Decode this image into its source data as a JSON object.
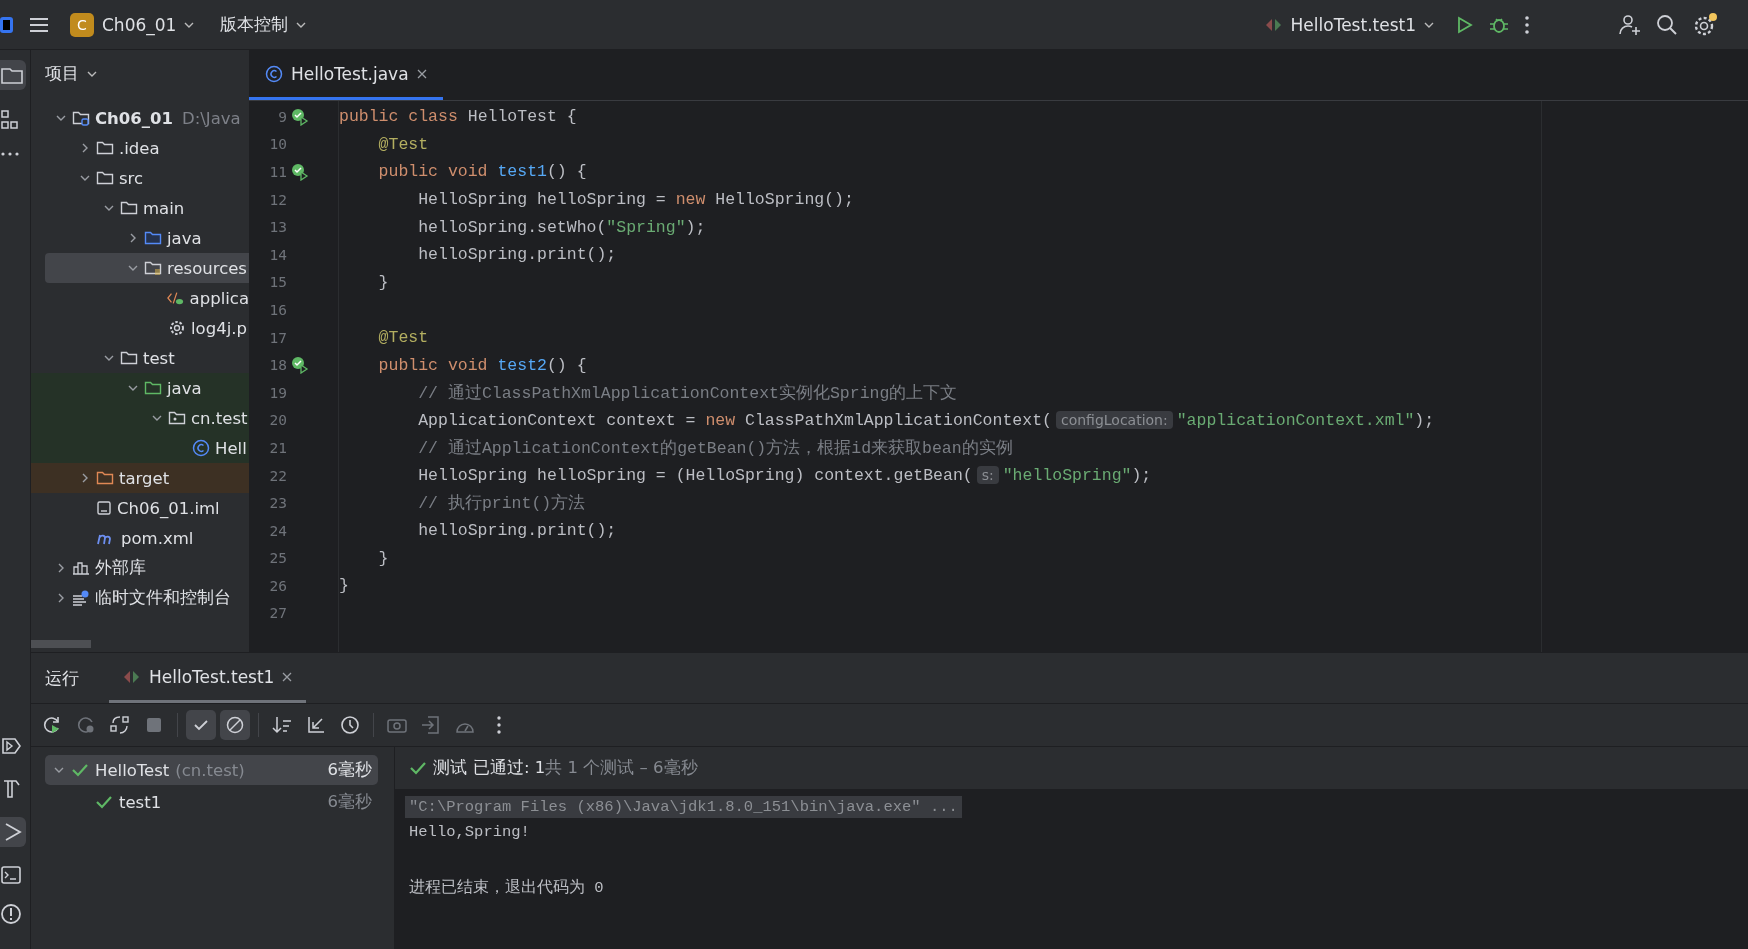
{
  "title_bar": {
    "project_badge": "C",
    "project": "Ch06_01",
    "vcs": "版本控制",
    "run_config": "HelloTest.test1",
    "settings_notice": true
  },
  "project_panel": {
    "title": "项目",
    "tree": [
      {
        "name": "Ch06_01",
        "hint": "D:\\Java",
        "kind": "project",
        "expanded": true,
        "selected": false,
        "children": [
          {
            "name": ".idea",
            "kind": "folder",
            "expanded": false,
            "selected": false
          },
          {
            "name": "src",
            "kind": "folder",
            "expanded": true,
            "selected": false,
            "children": [
              {
                "name": "main",
                "kind": "folder",
                "expanded": true,
                "selected": false,
                "children": [
                  {
                    "name": "java",
                    "kind": "source",
                    "expanded": false,
                    "selected": false
                  },
                  {
                    "name": "resources",
                    "kind": "resources",
                    "expanded": true,
                    "selected": true,
                    "children": [
                      {
                        "name": "applica",
                        "kind": "xml",
                        "selected": false
                      },
                      {
                        "name": "log4j.p",
                        "kind": "settings",
                        "selected": false
                      }
                    ]
                  }
                ]
              },
              {
                "name": "test",
                "kind": "folder",
                "expanded": true,
                "selected": false,
                "children": [
                  {
                    "name": "java",
                    "kind": "test_source",
                    "color": "#253227",
                    "expanded": true,
                    "selected": false,
                    "children": [
                      {
                        "name": "cn.test",
                        "kind": "package",
                        "color": "#253227",
                        "expanded": true,
                        "selected": false,
                        "children": [
                          {
                            "name": "Hell",
                            "kind": "class",
                            "color": "#253227",
                            "selected": false
                          }
                        ]
                      }
                    ]
                  }
                ]
              }
            ]
          },
          {
            "name": "target",
            "kind": "excluded",
            "color": "#3d3023",
            "expanded": false,
            "selected": false
          },
          {
            "name": "Ch06_01.iml",
            "kind": "module",
            "selected": false
          },
          {
            "name": "pom.xml",
            "kind": "maven",
            "selected": false
          }
        ]
      },
      {
        "name": "外部库",
        "kind": "library",
        "expanded": false,
        "selected": false
      },
      {
        "name": "临时文件和控制台",
        "kind": "scratch",
        "expanded": false,
        "selected": false
      }
    ]
  },
  "editor": {
    "tab": "HelloTest.java",
    "lines": [
      {
        "n": "9",
        "run_mark": true,
        "segments": [
          {
            "kind": "kw",
            "text": "public class "
          },
          {
            "kind": "plain",
            "text": "HelloTest {"
          }
        ]
      },
      {
        "n": "10",
        "run_mark": false,
        "segments": [
          {
            "kind": "ann",
            "text": "    @Test"
          }
        ]
      },
      {
        "n": "11",
        "run_mark": true,
        "segments": [
          {
            "kind": "kw",
            "text": "    public void "
          },
          {
            "kind": "fn",
            "text": "test1"
          },
          {
            "kind": "plain",
            "text": "() {"
          }
        ]
      },
      {
        "n": "12",
        "run_mark": false,
        "segments": [
          {
            "kind": "plain",
            "text": "        HelloSpring helloSpring = "
          },
          {
            "kind": "kw",
            "text": "new "
          },
          {
            "kind": "plain",
            "text": "HelloSpring();"
          }
        ]
      },
      {
        "n": "13",
        "run_mark": false,
        "segments": [
          {
            "kind": "plain",
            "text": "        helloSpring.setWho("
          },
          {
            "kind": "str",
            "text": "\"Spring\""
          },
          {
            "kind": "plain",
            "text": ");"
          }
        ]
      },
      {
        "n": "14",
        "run_mark": false,
        "segments": [
          {
            "kind": "plain",
            "text": "        helloSpring.print();"
          }
        ]
      },
      {
        "n": "15",
        "run_mark": false,
        "segments": [
          {
            "kind": "plain",
            "text": "    }"
          }
        ]
      },
      {
        "n": "16",
        "run_mark": false
      },
      {
        "n": "17",
        "run_mark": false,
        "segments": [
          {
            "kind": "ann",
            "text": "    @Test"
          }
        ]
      },
      {
        "n": "18",
        "run_mark": true,
        "segments": [
          {
            "kind": "kw",
            "text": "    public void "
          },
          {
            "kind": "fn",
            "text": "test2"
          },
          {
            "kind": "plain",
            "text": "() {"
          }
        ]
      },
      {
        "n": "19",
        "run_mark": false,
        "segments": [
          {
            "kind": "cmt",
            "text": "        // 通过ClassPathXmlApplicationContext实例化Spring的上下文"
          }
        ]
      },
      {
        "n": "20",
        "run_mark": false,
        "segments": [
          {
            "kind": "plain",
            "text": "        ApplicationContext context = "
          },
          {
            "kind": "kw",
            "text": "new "
          },
          {
            "kind": "plain",
            "text": "ClassPathXmlApplicationContext("
          },
          {
            "kind": "hint",
            "text": "configLocation:"
          },
          {
            "kind": "str",
            "text": "\"applicationContext.xml\""
          },
          {
            "kind": "plain",
            "text": ");"
          }
        ]
      },
      {
        "n": "21",
        "run_mark": false,
        "segments": [
          {
            "kind": "cmt",
            "text": "        // 通过ApplicationContext的getBean()方法，根据id来获取bean的实例"
          }
        ]
      },
      {
        "n": "22",
        "run_mark": false,
        "segments": [
          {
            "kind": "plain",
            "text": "        HelloSpring helloSpring = (HelloSpring) context.getBean("
          },
          {
            "kind": "hint",
            "text": "s:"
          },
          {
            "kind": "str",
            "text": "\"helloSpring\""
          },
          {
            "kind": "plain",
            "text": ");"
          }
        ]
      },
      {
        "n": "23",
        "run_mark": false,
        "segments": [
          {
            "kind": "cmt",
            "text": "        // 执行print()方法"
          }
        ]
      },
      {
        "n": "24",
        "run_mark": false,
        "segments": [
          {
            "kind": "plain",
            "text": "        helloSpring.print();"
          }
        ]
      },
      {
        "n": "25",
        "run_mark": false,
        "segments": [
          {
            "kind": "plain",
            "text": "    }"
          }
        ]
      },
      {
        "n": "26",
        "run_mark": false,
        "segments": [
          {
            "kind": "plain",
            "text": "}"
          }
        ]
      },
      {
        "n": "27",
        "run_mark": false
      }
    ]
  },
  "run_panel": {
    "title": "运行",
    "tab": "HelloTest.test1",
    "toolbar": [
      {
        "kind": "rerun",
        "on": false
      },
      {
        "kind": "rerun_failed",
        "on": false
      },
      {
        "kind": "toggle_auto",
        "on": false
      },
      {
        "kind": "stop",
        "on": false
      },
      {
        "kind": "show_passed",
        "on": true
      },
      {
        "kind": "show_ignored",
        "on": true
      },
      {
        "kind": "sort",
        "on": false
      },
      {
        "kind": "collapse",
        "on": false
      },
      {
        "kind": "history",
        "on": false
      },
      {
        "kind": "camera",
        "on": false
      },
      {
        "kind": "import",
        "on": false
      },
      {
        "kind": "gauge",
        "on": false
      },
      {
        "kind": "more",
        "on": false
      }
    ],
    "tests": [
      {
        "name": "HelloTest",
        "package": "(cn.test)",
        "time": "6毫秒",
        "expanded": true,
        "selected": true,
        "children": [
          {
            "name": "test1",
            "time": "6毫秒",
            "selected": false
          }
        ]
      }
    ],
    "status": {
      "label": "测试",
      "passed": "已通过: 1",
      "total": "共 1 个测试 – 6毫秒"
    },
    "console": [
      {
        "kind": "command",
        "text": "\"C:\\Program Files (x86)\\Java\\jdk1.8.0_151\\bin\\java.exe\" ..."
      },
      {
        "kind": "output",
        "text": "Hello,Spring!"
      },
      {
        "kind": "blank"
      },
      {
        "kind": "output",
        "text": "进程已结束，退出代码为 0"
      }
    ]
  }
}
